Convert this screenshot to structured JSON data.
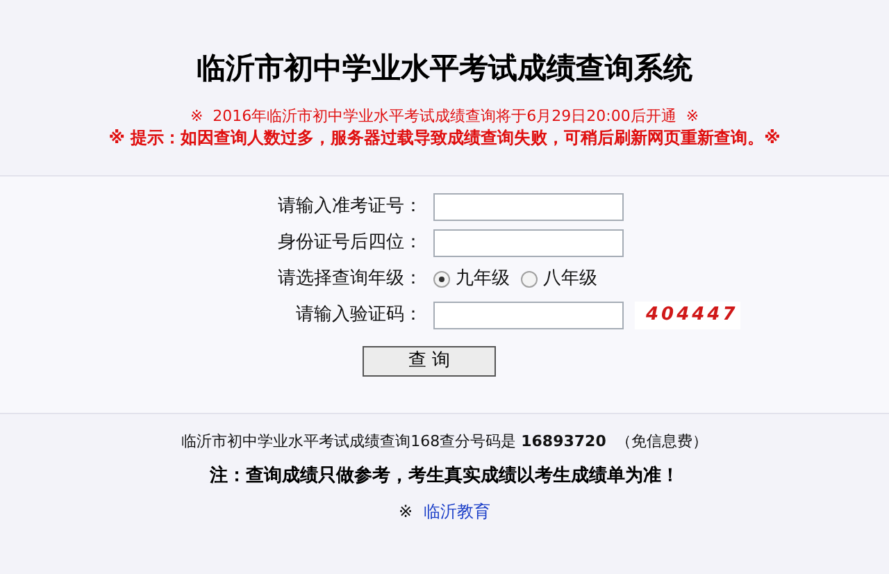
{
  "header": {
    "title": "临沂市初中学业水平考试成绩查询系统",
    "notice": "※  2016年临沂市初中学业水平考试成绩查询将于6月29日20:00后开通  ※",
    "tip": "※ 提示：如因查询人数过多，服务器过载导致成绩查询失败，可稍后刷新网页重新查询。※"
  },
  "form": {
    "fields": [
      {
        "kind": "text",
        "label": "请输入准考证号："
      },
      {
        "kind": "text",
        "label": "身份证号后四位："
      },
      {
        "kind": "radio",
        "label": "请选择查询年级：",
        "options": [
          {
            "label": "九年级",
            "selected": true
          },
          {
            "label": "八年级",
            "selected": false
          }
        ]
      },
      {
        "kind": "captcha",
        "label": "请输入验证码：",
        "code": "404447"
      }
    ],
    "submit": "查 询"
  },
  "footer": {
    "hotline": "临沂市初中学业水平考试成绩查询168查分号码是 **16893720**  （免信息费）",
    "note": "注：查询成绩只做参考，考生真实成绩以考生成绩单为准！",
    "mark": "※",
    "link": "临沂教育"
  }
}
